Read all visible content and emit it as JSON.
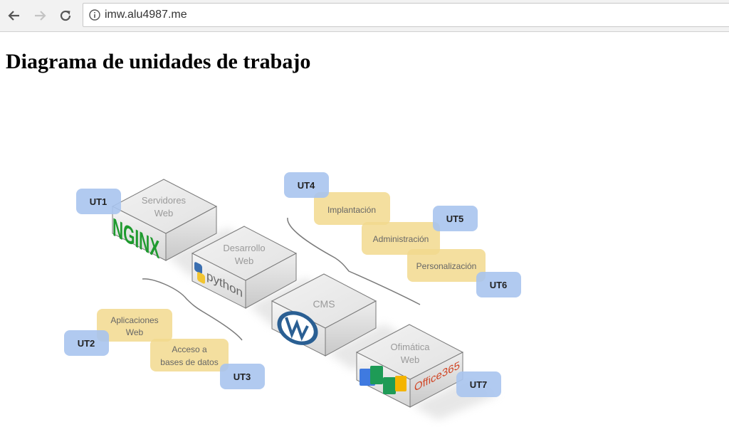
{
  "browser": {
    "url": "imw.alu4987.me"
  },
  "page": {
    "title": "Diagrama de unidades de trabajo"
  },
  "diagram": {
    "boxes": {
      "servidores": [
        "Servidores",
        "Web"
      ],
      "desarrollo": [
        "Desarrollo",
        "Web"
      ],
      "cms": [
        "CMS"
      ],
      "ofimatica": [
        "Ofimática",
        "Web"
      ]
    },
    "logos": {
      "nginx": "NGINX",
      "python": "python",
      "office": "Office365"
    },
    "tasks": {
      "aplicaciones": [
        "Aplicaciones",
        "Web"
      ],
      "acceso": [
        "Acceso a",
        "bases de datos"
      ],
      "implantacion": [
        "Implantación"
      ],
      "administracion": [
        "Administración"
      ],
      "personalizacion": [
        "Personalización"
      ]
    },
    "units": {
      "ut1": "UT1",
      "ut2": "UT2",
      "ut3": "UT3",
      "ut4": "UT4",
      "ut5": "UT5",
      "ut6": "UT6",
      "ut7": "UT7"
    },
    "colors": {
      "unit_fill": "#a9c4ee",
      "task_fill": "#f2d98e",
      "box_top": "#ececec",
      "box_text": "#9a9a9a"
    }
  }
}
